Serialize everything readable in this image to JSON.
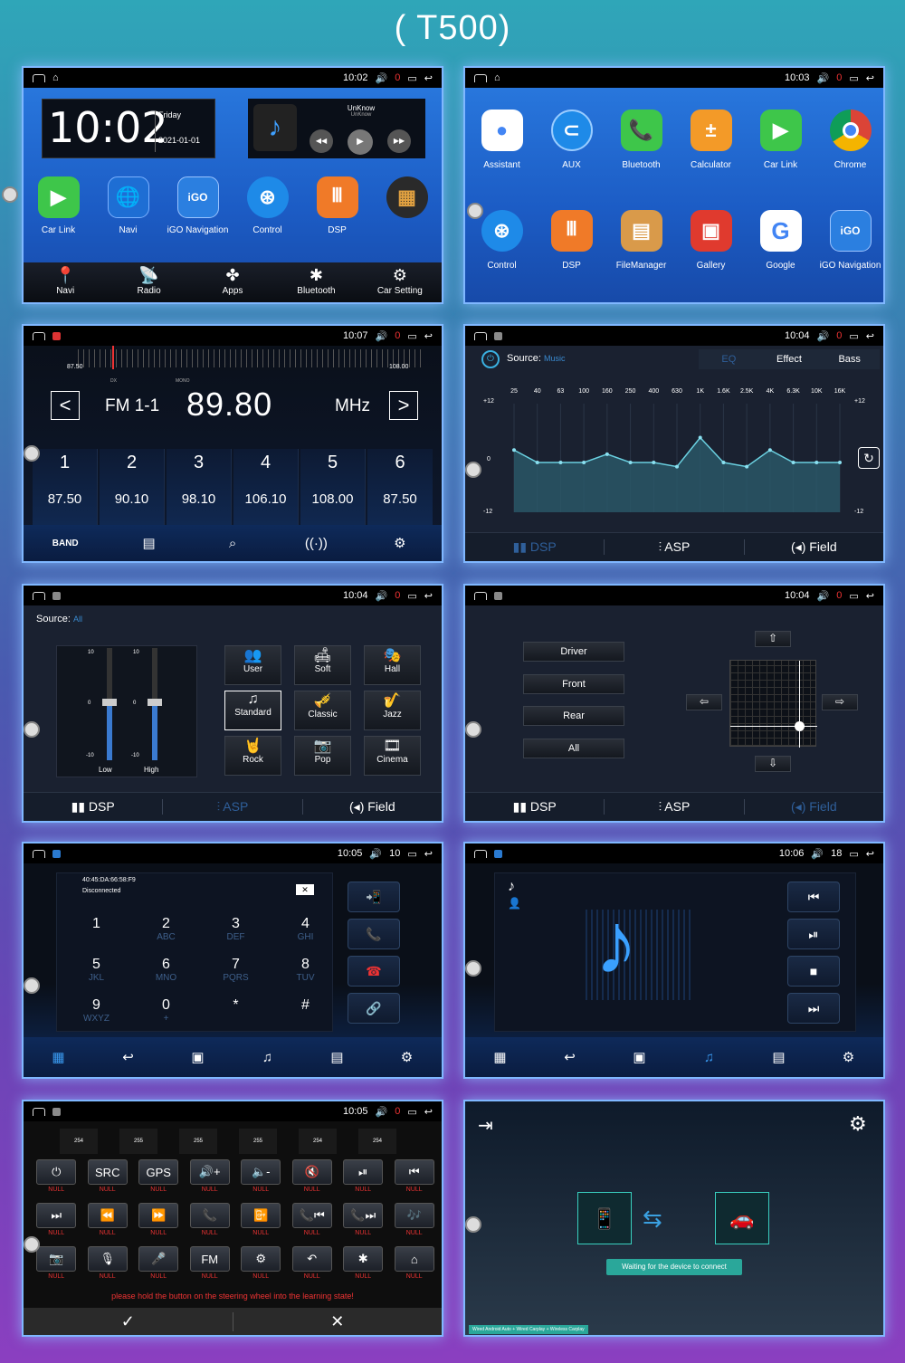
{
  "title": "( T500)",
  "home": {
    "time": "10:02",
    "day": "Friday",
    "date": "2021-01-01",
    "status_time": "10:02",
    "status_val": "0",
    "song": "UnKnow",
    "artist": "UnKnow",
    "apps": [
      "Car Link",
      "Navi",
      "iGO Navigation",
      "Control",
      "DSP"
    ],
    "dock": [
      "Navi",
      "Radio",
      "Apps",
      "Bluetooth",
      "Car Setting"
    ]
  },
  "apps": {
    "status_time": "10:03",
    "status_val": "0",
    "row1": [
      "Assistant",
      "AUX",
      "Bluetooth",
      "Calculator",
      "Car Link",
      "Chrome"
    ],
    "row2": [
      "Control",
      "DSP",
      "FileManager",
      "Gallery",
      "Google",
      "iGO Navigation"
    ]
  },
  "radio": {
    "status_time": "10:07",
    "status_val": "0",
    "scale_min": "87.50",
    "scale_max": "108.00",
    "dx": "DX",
    "mono": "MONO",
    "band": "FM 1-1",
    "freq": "89.80",
    "unit": "MHz",
    "band_btn": "BAND",
    "presets": [
      {
        "n": "1",
        "f": "87.50"
      },
      {
        "n": "2",
        "f": "90.10"
      },
      {
        "n": "3",
        "f": "98.10"
      },
      {
        "n": "4",
        "f": "106.10"
      },
      {
        "n": "5",
        "f": "108.00"
      },
      {
        "n": "6",
        "f": "87.50"
      }
    ]
  },
  "eq": {
    "status_time": "10:04",
    "status_val": "0",
    "source_label": "Source:",
    "source": "Music",
    "tabs": [
      "EQ",
      "Effect",
      "Bass"
    ],
    "bands": [
      "25",
      "40",
      "63",
      "100",
      "160",
      "250",
      "400",
      "630",
      "1K",
      "1.6K",
      "2.5K",
      "4K",
      "6.3K",
      "10K",
      "16K"
    ],
    "y_top": "+12",
    "y_mid": "0",
    "y_bot": "-12",
    "bottom": [
      "DSP",
      "ASP",
      "Field"
    ]
  },
  "asp": {
    "status_time": "10:04",
    "status_val": "0",
    "source_label": "Source:",
    "source": "All",
    "slider_top": "10",
    "slider_mid": "0",
    "slider_bot": "-10",
    "slider_labels": [
      "Low",
      "High"
    ],
    "presets": [
      "User",
      "Soft",
      "Hall",
      "Standard",
      "Classic",
      "Jazz",
      "Rock",
      "Pop",
      "Cinema"
    ],
    "bottom": [
      "DSP",
      "ASP",
      "Field"
    ]
  },
  "field": {
    "status_time": "10:04",
    "status_val": "0",
    "buttons": [
      "Driver",
      "Front",
      "Rear",
      "All"
    ],
    "bottom": [
      "DSP",
      "ASP",
      "Field"
    ]
  },
  "phone": {
    "status_time": "10:05",
    "status_val": "10",
    "mac": "40:45:DA:66:58:F9",
    "state": "Disconnected",
    "keys": [
      {
        "d": "1",
        "l": ""
      },
      {
        "d": "2",
        "l": "ABC"
      },
      {
        "d": "3",
        "l": "DEF"
      },
      {
        "d": "4",
        "l": "GHI"
      },
      {
        "d": "5",
        "l": "JKL"
      },
      {
        "d": "6",
        "l": "MNO"
      },
      {
        "d": "7",
        "l": "PQRS"
      },
      {
        "d": "8",
        "l": "TUV"
      },
      {
        "d": "9",
        "l": "WXYZ"
      },
      {
        "d": "0",
        "l": "+"
      },
      {
        "d": "*",
        "l": ""
      },
      {
        "d": "#",
        "l": ""
      }
    ]
  },
  "btmusic": {
    "status_time": "10:06",
    "status_val": "18"
  },
  "steering": {
    "status_time": "10:05",
    "status_val": "0",
    "values": [
      "254",
      "255",
      "255",
      "255",
      "254",
      "254"
    ],
    "buttons": [
      "⏻",
      "SRC",
      "GPS",
      "🔊+",
      "🔈-",
      "🔇",
      "⏯",
      "⏮",
      "⏭",
      "⏪",
      "⏩",
      "📞",
      "📴",
      "📞⏮",
      "📞⏭",
      "🎶",
      "📷",
      "🎙",
      "🎤",
      "FM",
      "⚙",
      "↶",
      "✱",
      "⌂"
    ],
    "null": "NULL",
    "hint": "please hold the button on the steering wheel into the learning state!"
  },
  "carplay": {
    "waiting": "Waiting for the device to connect",
    "footer": "Wired Android Auto + Wired Carplay + Wireless Carplay"
  }
}
